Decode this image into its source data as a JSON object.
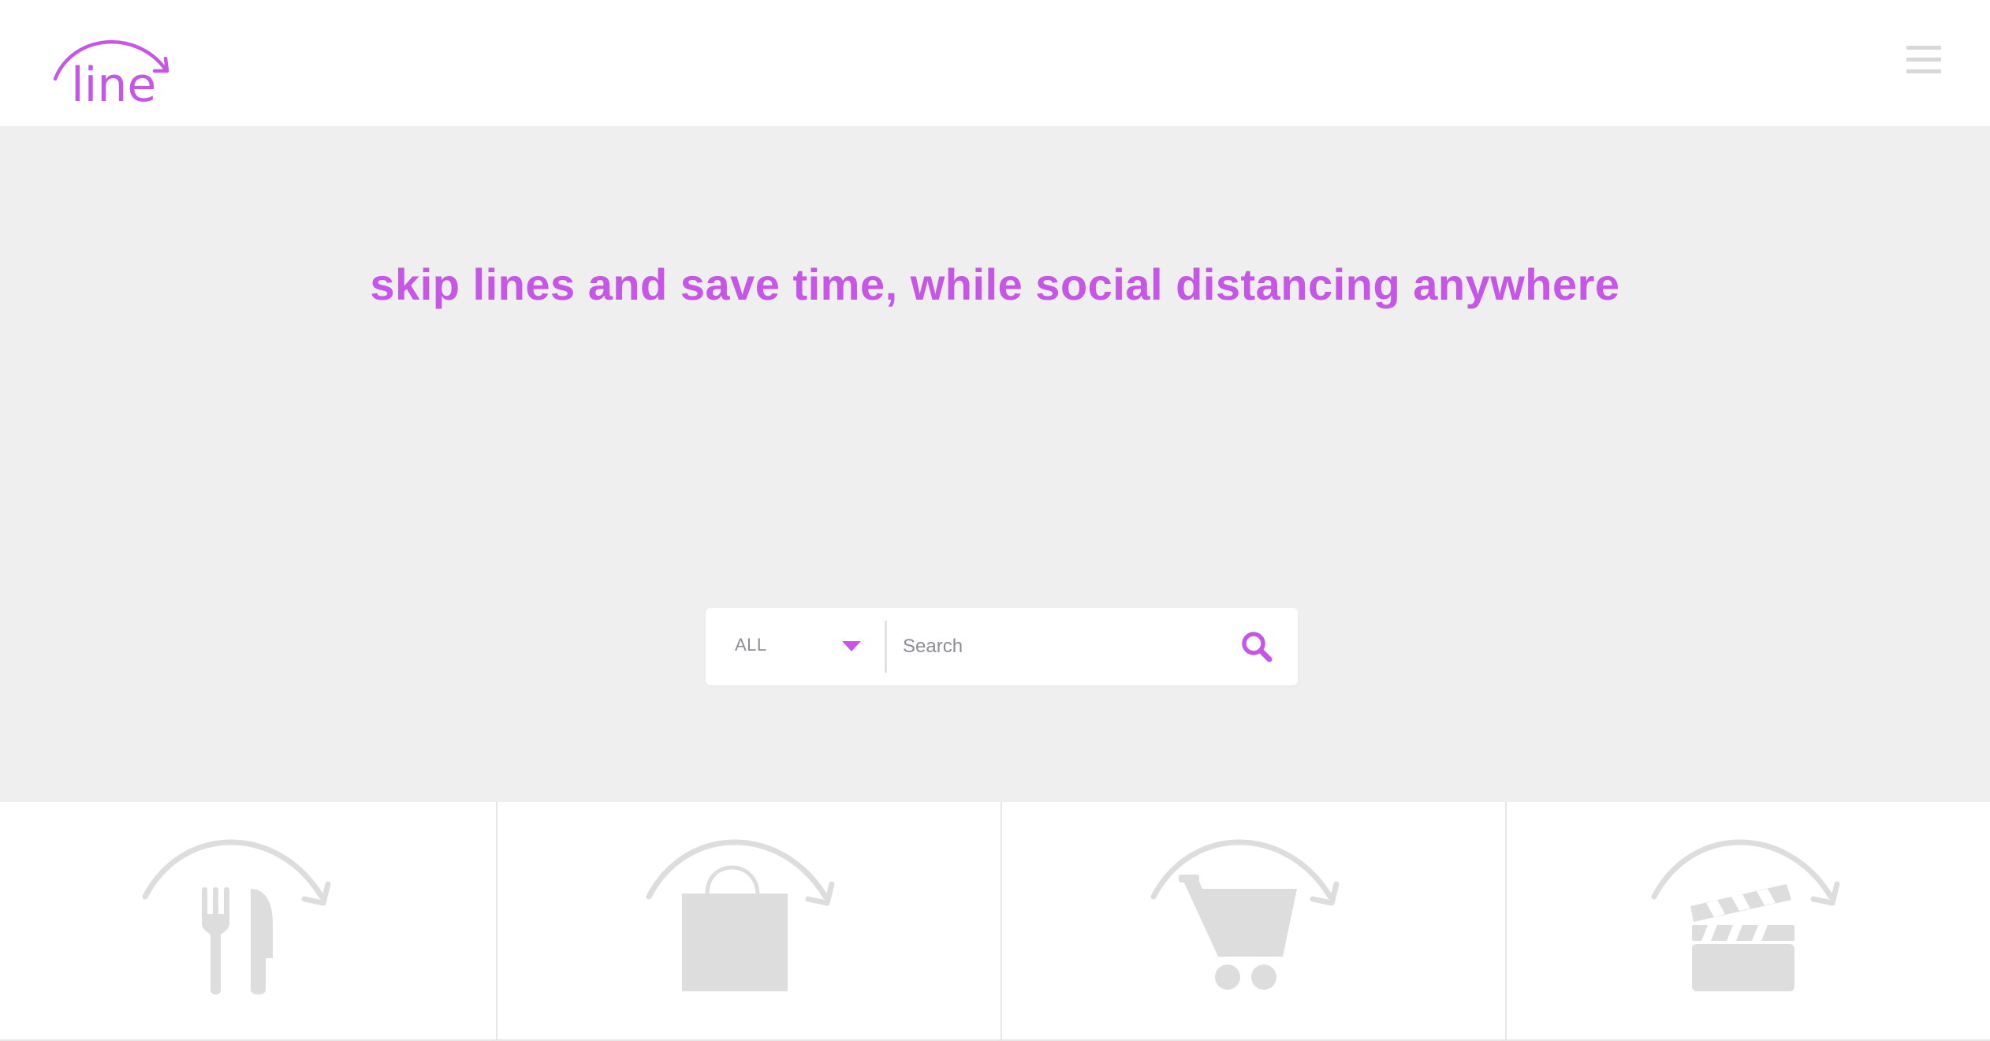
{
  "header": {
    "logo_text": "line",
    "menu_icon": "hamburger-menu-icon"
  },
  "hero": {
    "tagline": "skip lines and save time, while social distancing anywhere"
  },
  "search": {
    "category_selected": "ALL",
    "placeholder": "Search",
    "value": "",
    "button_icon": "search-icon"
  },
  "categories": [
    {
      "icon": "restaurant-icon"
    },
    {
      "icon": "shopping-bag-icon"
    },
    {
      "icon": "shopping-cart-icon"
    },
    {
      "icon": "movie-clapperboard-icon"
    }
  ],
  "colors": {
    "brand": "#c656e6",
    "hero_background": "#efefef",
    "icon_gray": "#dddddd",
    "placeholder": "#8d8d97"
  }
}
